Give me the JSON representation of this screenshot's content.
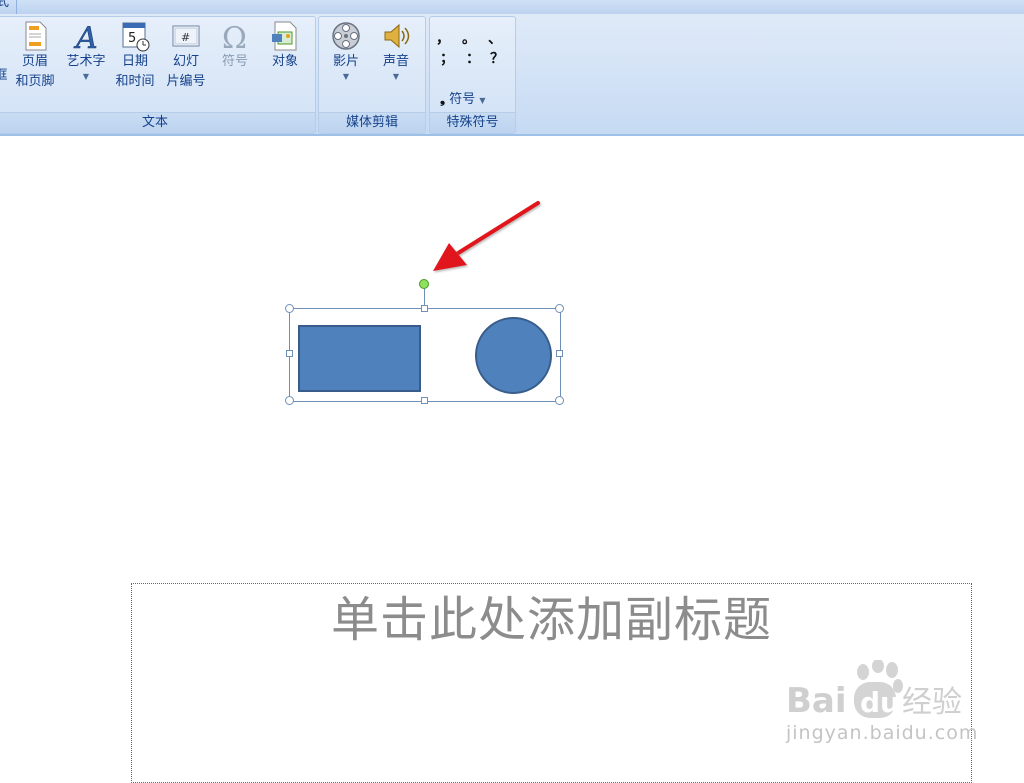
{
  "ribbon": {
    "tab_partial_label": "式",
    "groups": {
      "text": {
        "label": "文本",
        "buttons": [
          {
            "line1": "框",
            "line2": ""
          },
          {
            "line1": "页眉",
            "line2": "和页脚"
          },
          {
            "line1": "艺术字",
            "line2": ""
          },
          {
            "line1": "日期",
            "line2": "和时间"
          },
          {
            "line1": "幻灯",
            "line2": "片编号"
          },
          {
            "line1": "符号",
            "line2": ""
          },
          {
            "line1": "对象",
            "line2": ""
          }
        ]
      },
      "media": {
        "label": "媒体剪辑",
        "buttons": [
          {
            "line1": "影片"
          },
          {
            "line1": "声音"
          }
        ]
      },
      "special": {
        "label": "特殊符号",
        "symbols": [
          "，",
          "。",
          "、",
          "；",
          "：",
          "？"
        ],
        "symbol_button": "符号"
      }
    }
  },
  "slide": {
    "subtitle_placeholder": "单击此处添加副标题"
  },
  "colors": {
    "shape_fill": "#4f81bd",
    "shape_border": "#385d8a",
    "arrow": "#e0191b"
  },
  "watermark": {
    "text": "jingyan.baidu.com"
  }
}
